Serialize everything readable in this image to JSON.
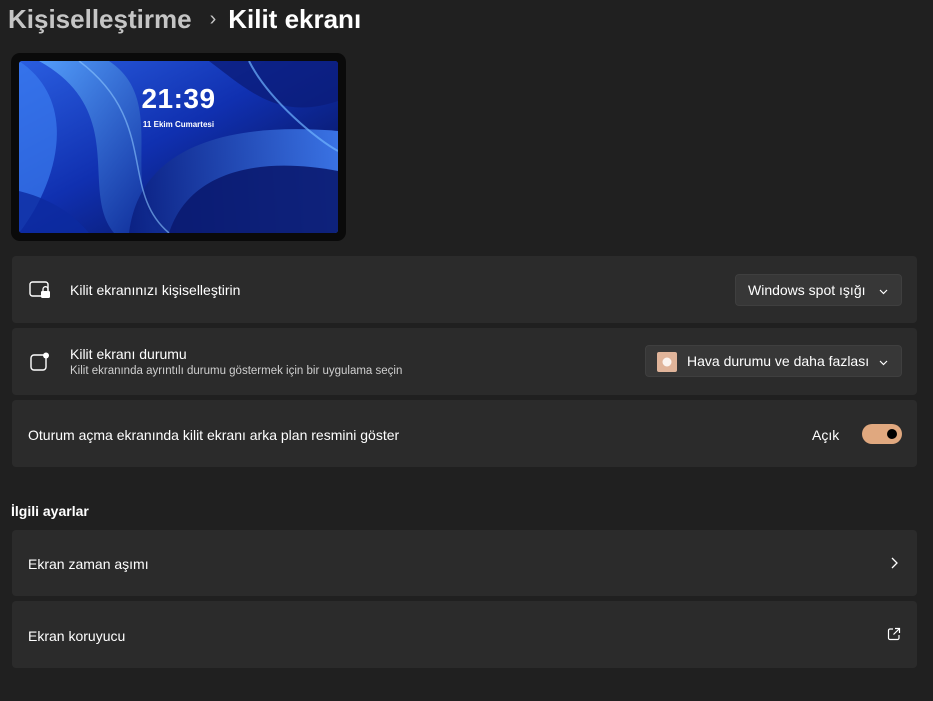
{
  "breadcrumb": {
    "parent": "Kişiselleştirme",
    "separator": "›",
    "current": "Kilit ekranı"
  },
  "preview": {
    "time": "21:39",
    "date": "11 Ekim Cumartesi"
  },
  "settings": {
    "personalize": {
      "label": "Kilit ekranınızı kişiselleştirin",
      "icon": "lock-screen-icon",
      "value": "Windows spot ışığı"
    },
    "status": {
      "label": "Kilit ekranı durumu",
      "description": "Kilit ekranında ayrıntılı durumu göstermek için bir uygulama seçin",
      "icon": "status-icon",
      "value": "Hava durumu ve daha fazlası",
      "value_icon": "weather-icon"
    },
    "signin_background": {
      "label": "Oturum açma ekranında kilit ekranı arka plan resmini göster",
      "state_label": "Açık",
      "on": true
    }
  },
  "related": {
    "title": "İlgili ayarlar",
    "items": [
      {
        "label": "Ekran zaman aşımı",
        "icon": "chevron-right-icon"
      },
      {
        "label": "Ekran koruyucu",
        "icon": "external-link-icon"
      }
    ]
  },
  "colors": {
    "background": "#202020",
    "card": "#2b2b2b",
    "accent": "#e0a87f"
  }
}
